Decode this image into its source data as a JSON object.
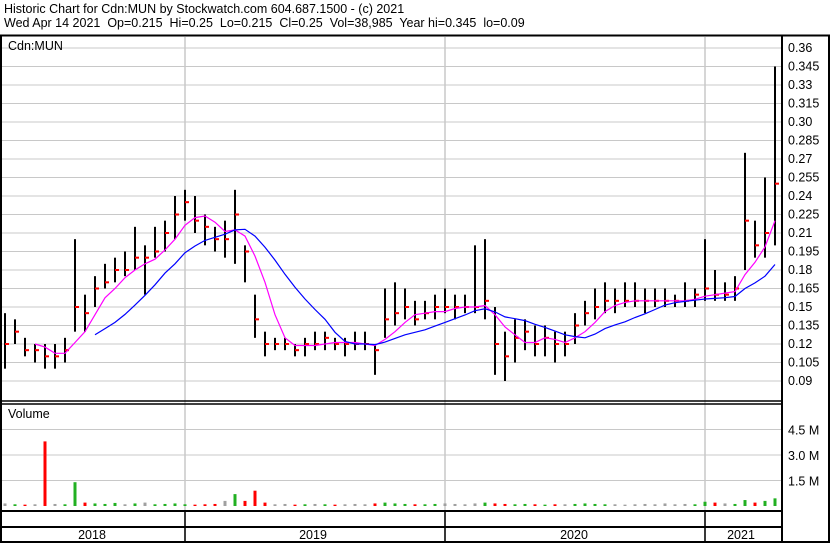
{
  "header": {
    "title": "Historic Chart for Cdn:MUN by Stockwatch.com 604.687.1500 - (c) 2021",
    "quote": "Wed Apr 14 2021  Op=0.215  Hi=0.25  Lo=0.215  Cl=0.25  Vol=38,985  Year hi=0.345  lo=0.09"
  },
  "chart_data": {
    "type": "bar",
    "title": "Cdn:MUN",
    "volume_label": "Volume",
    "price_ticks": [
      "0.36",
      "0.345",
      "0.33",
      "0.315",
      "0.30",
      "0.285",
      "0.27",
      "0.255",
      "0.24",
      "0.225",
      "0.21",
      "0.195",
      "0.18",
      "0.165",
      "0.15",
      "0.135",
      "0.12",
      "0.105",
      "0.09"
    ],
    "ylim": [
      0.0825,
      0.3675
    ],
    "volume_ticks": [
      {
        "label": "4.5 M",
        "value": 4.5
      },
      {
        "label": "3.0 M",
        "value": 3.0
      },
      {
        "label": "1.5 M",
        "value": 1.5
      }
    ],
    "volume_ylim": [
      0,
      5.3
    ],
    "year_labels": [
      "2018",
      "2019",
      "2020",
      "2021"
    ],
    "moving_averages": [
      {
        "name": "short MA",
        "color": "#ff00ff",
        "period": 4
      },
      {
        "name": "long MA",
        "color": "#0000ff",
        "period": 10
      }
    ],
    "colors": {
      "bar": "#000000",
      "close_tick": "#ff0000",
      "vol_up": "#22b022",
      "vol_down": "#ff0000",
      "vol_flat": "#a0a0a0",
      "grid": "#c8c8c8"
    },
    "close": [
      0.12,
      0.13,
      0.115,
      0.115,
      0.11,
      0.11,
      0.115,
      0.15,
      0.145,
      0.165,
      0.17,
      0.18,
      0.18,
      0.19,
      0.19,
      0.195,
      0.21,
      0.225,
      0.235,
      0.22,
      0.215,
      0.205,
      0.205,
      0.225,
      0.195,
      0.14,
      0.12,
      0.12,
      0.12,
      0.115,
      0.12,
      0.12,
      0.125,
      0.12,
      0.12,
      0.12,
      0.12,
      0.115,
      0.14,
      0.145,
      0.15,
      0.14,
      0.145,
      0.15,
      0.15,
      0.15,
      0.15,
      0.15,
      0.155,
      0.12,
      0.11,
      0.125,
      0.13,
      0.12,
      0.125,
      0.12,
      0.12,
      0.135,
      0.145,
      0.15,
      0.155,
      0.155,
      0.155,
      0.155,
      0.155,
      0.155,
      0.155,
      0.155,
      0.155,
      0.16,
      0.165,
      0.16,
      0.16,
      0.165,
      0.22,
      0.2,
      0.21,
      0.25
    ],
    "high": [
      0.145,
      0.14,
      0.125,
      0.12,
      0.12,
      0.12,
      0.125,
      0.205,
      0.16,
      0.175,
      0.185,
      0.19,
      0.195,
      0.215,
      0.2,
      0.215,
      0.22,
      0.24,
      0.245,
      0.24,
      0.225,
      0.215,
      0.22,
      0.245,
      0.2,
      0.16,
      0.13,
      0.125,
      0.125,
      0.12,
      0.125,
      0.13,
      0.13,
      0.125,
      0.125,
      0.13,
      0.13,
      0.12,
      0.165,
      0.17,
      0.165,
      0.155,
      0.155,
      0.16,
      0.165,
      0.16,
      0.16,
      0.2,
      0.205,
      0.15,
      0.13,
      0.14,
      0.14,
      0.135,
      0.135,
      0.13,
      0.13,
      0.145,
      0.155,
      0.165,
      0.17,
      0.165,
      0.17,
      0.17,
      0.165,
      0.165,
      0.165,
      0.16,
      0.17,
      0.165,
      0.205,
      0.18,
      0.17,
      0.175,
      0.275,
      0.22,
      0.255,
      0.345
    ],
    "low": [
      0.1,
      0.12,
      0.11,
      0.105,
      0.1,
      0.1,
      0.105,
      0.13,
      0.13,
      0.15,
      0.165,
      0.17,
      0.175,
      0.18,
      0.16,
      0.19,
      0.195,
      0.205,
      0.22,
      0.21,
      0.2,
      0.195,
      0.19,
      0.185,
      0.17,
      0.125,
      0.11,
      0.115,
      0.115,
      0.11,
      0.11,
      0.115,
      0.115,
      0.115,
      0.11,
      0.115,
      0.115,
      0.095,
      0.125,
      0.135,
      0.14,
      0.135,
      0.14,
      0.14,
      0.145,
      0.14,
      0.145,
      0.145,
      0.14,
      0.095,
      0.09,
      0.105,
      0.115,
      0.11,
      0.11,
      0.105,
      0.11,
      0.12,
      0.135,
      0.14,
      0.145,
      0.145,
      0.15,
      0.15,
      0.145,
      0.15,
      0.15,
      0.15,
      0.15,
      0.15,
      0.155,
      0.155,
      0.155,
      0.155,
      0.18,
      0.19,
      0.19,
      0.2
    ],
    "volume_m": [
      0.15,
      0.1,
      0.08,
      0.1,
      3.8,
      0.12,
      0.1,
      1.4,
      0.2,
      0.15,
      0.12,
      0.18,
      0.1,
      0.15,
      0.2,
      0.1,
      0.12,
      0.15,
      0.1,
      0.08,
      0.1,
      0.12,
      0.3,
      0.7,
      0.3,
      0.9,
      0.2,
      0.1,
      0.12,
      0.08,
      0.1,
      0.12,
      0.1,
      0.08,
      0.1,
      0.12,
      0.1,
      0.15,
      0.2,
      0.15,
      0.12,
      0.1,
      0.1,
      0.12,
      0.15,
      0.12,
      0.1,
      0.15,
      0.2,
      0.15,
      0.12,
      0.1,
      0.12,
      0.1,
      0.08,
      0.1,
      0.1,
      0.12,
      0.15,
      0.12,
      0.1,
      0.1,
      0.08,
      0.1,
      0.12,
      0.1,
      0.15,
      0.1,
      0.12,
      0.1,
      0.25,
      0.2,
      0.15,
      0.12,
      0.35,
      0.2,
      0.3,
      0.45
    ]
  }
}
